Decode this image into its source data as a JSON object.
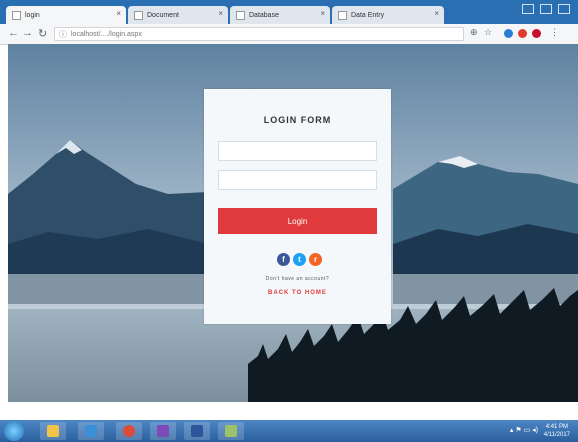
{
  "browser": {
    "tabs": [
      {
        "label": "login",
        "active": true
      },
      {
        "label": "Document",
        "active": false
      },
      {
        "label": "Database",
        "active": false
      },
      {
        "label": "Data Entry",
        "active": false
      }
    ],
    "url": "localhost/..../login.aspx",
    "back_icon": "arrow-left-icon",
    "forward_icon": "arrow-right-icon",
    "reload_icon": "reload-icon"
  },
  "login": {
    "title": "LOGIN FORM",
    "username_placeholder": "",
    "password_placeholder": "",
    "button_label": "Login",
    "social": [
      {
        "name": "facebook-icon",
        "glyph": "f",
        "color": "#3b5998"
      },
      {
        "name": "twitter-icon",
        "glyph": "t",
        "color": "#1da1f2"
      },
      {
        "name": "rss-icon",
        "glyph": "r",
        "color": "#f26522"
      }
    ],
    "no_account_text": "Don't have an account?",
    "back_home_text": "BACK TO HOME"
  },
  "colors": {
    "accent": "#e03a3c",
    "taskbar": "#2a5f9e"
  },
  "taskbar": {
    "clock_time": "4:41 PM",
    "clock_date": "4/11/2017"
  }
}
